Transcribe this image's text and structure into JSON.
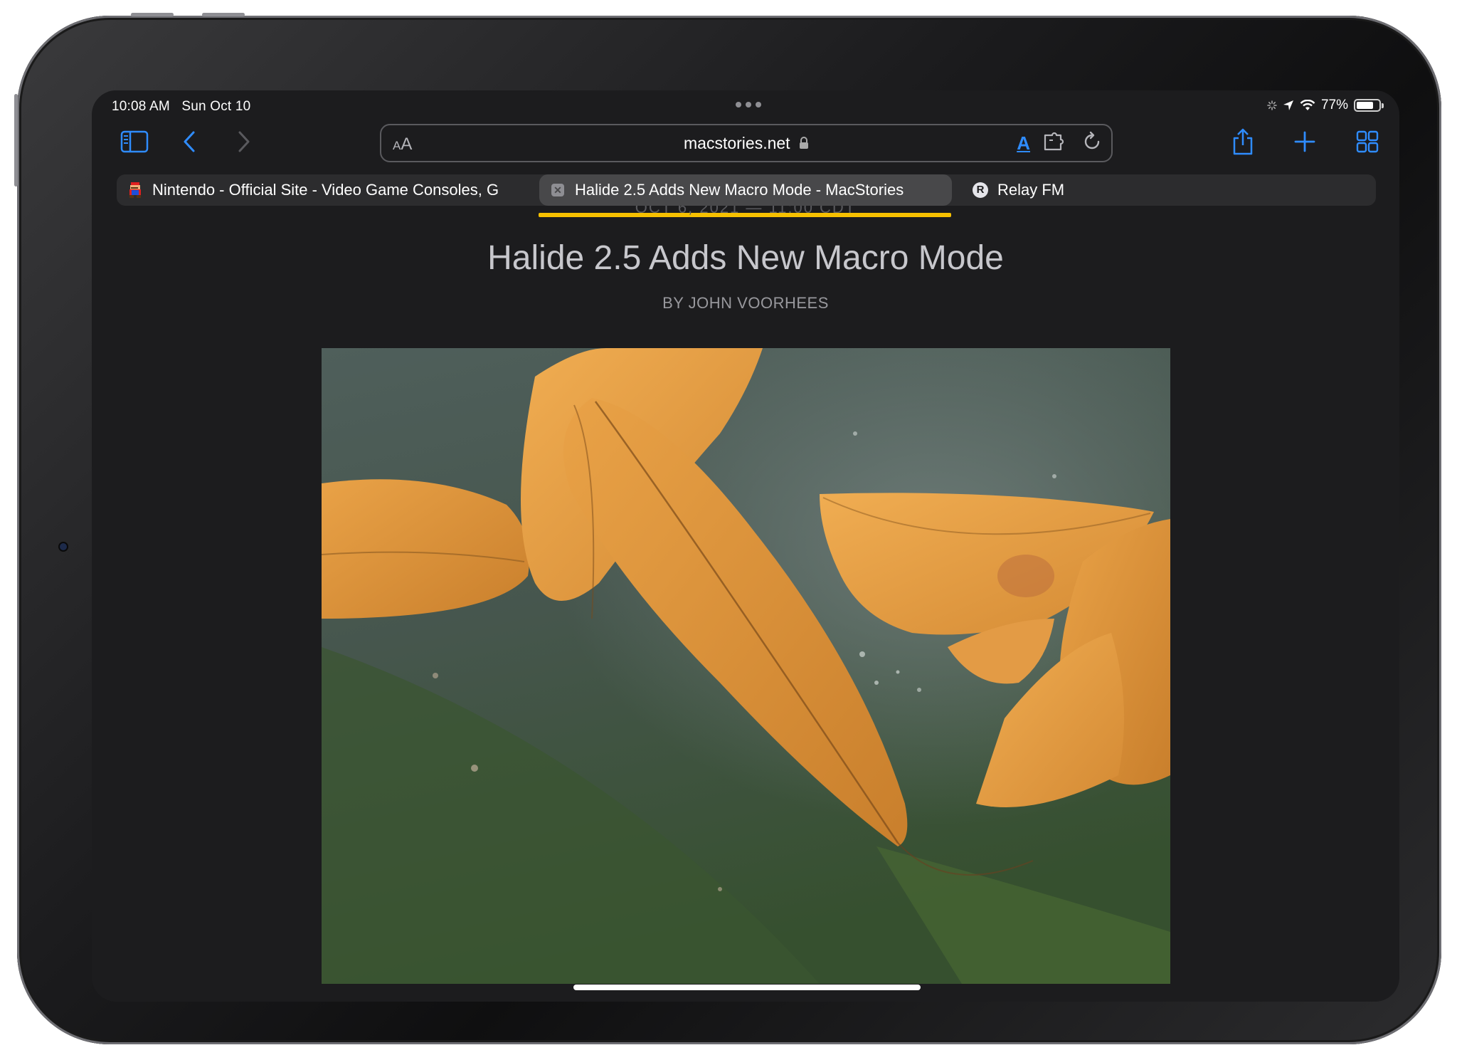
{
  "status_bar": {
    "time": "10:08 AM",
    "date": "Sun Oct 10",
    "battery_percent": "77%",
    "battery_level": 0.77,
    "icons": [
      "location-arrow-icon",
      "wifi-icon",
      "battery-icon"
    ]
  },
  "toolbar": {
    "text_size_label": "AA",
    "url": "macstories.net",
    "reader_label": "A",
    "icons": [
      "sidebar-icon",
      "back-icon",
      "forward-icon",
      "extension-icon",
      "reload-icon",
      "share-icon",
      "new-tab-icon",
      "tab-overview-icon"
    ]
  },
  "tabs": [
    {
      "title": "Nintendo - Official Site - Video Game Consoles, G",
      "favicon": "mario-icon",
      "active": false
    },
    {
      "title": "Halide 2.5 Adds New Macro Mode - MacStories",
      "favicon": "close-icon",
      "active": true
    },
    {
      "title": "Relay FM",
      "favicon": "relay-fm-icon",
      "active": false
    }
  ],
  "page_load_progress": 1.0,
  "article": {
    "dateline": "OCT 6, 2021 — 11:00 CDT",
    "title": "Halide 2.5 Adds New Macro Mode",
    "byline": "BY JOHN VOORHEES",
    "image_subject": "macro photo of orange leaves on a green leaf"
  },
  "colors": {
    "accent": "#2f8cff",
    "progress": "#f6c000",
    "background": "#1c1c1e"
  }
}
